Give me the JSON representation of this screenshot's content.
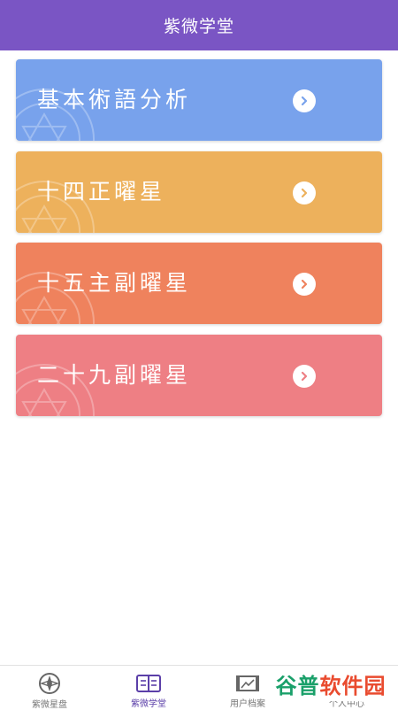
{
  "header": {
    "title": "紫微学堂"
  },
  "cards": [
    {
      "label": "基本術語分析",
      "color": "#78a2ec",
      "icon": "chevron-right-icon"
    },
    {
      "label": "十四正曜星",
      "color": "#edb15c",
      "icon": "chevron-right-icon"
    },
    {
      "label": "十五主副曜星",
      "color": "#ef825d",
      "icon": "chevron-right-icon"
    },
    {
      "label": "二十九副曜星",
      "color": "#ee7f84",
      "icon": "chevron-right-icon"
    }
  ],
  "tabs": [
    {
      "label": "紫微星盘",
      "icon": "compass-icon",
      "active": false
    },
    {
      "label": "紫微学堂",
      "icon": "book-icon",
      "active": true
    },
    {
      "label": "用户档案",
      "icon": "archive-icon",
      "active": false
    },
    {
      "label": "个人中心",
      "icon": "person-icon",
      "active": false
    }
  ],
  "watermark": {
    "part1": "谷普",
    "part2": "软件园"
  },
  "colors": {
    "header": "#7a55c4",
    "active_tab": "#5b3fa8"
  }
}
